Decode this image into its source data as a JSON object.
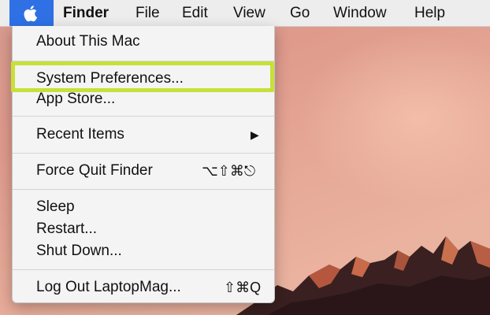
{
  "menubar": {
    "apple_icon": "apple-logo",
    "items": [
      {
        "label": "Finder"
      },
      {
        "label": "File"
      },
      {
        "label": "Edit"
      },
      {
        "label": "View"
      },
      {
        "label": "Go"
      },
      {
        "label": "Window"
      },
      {
        "label": "Help"
      }
    ]
  },
  "apple_menu": {
    "items": [
      {
        "label": "About This Mac"
      },
      {
        "label": "System Preferences..."
      },
      {
        "label": "App Store..."
      },
      {
        "label": "Recent Items",
        "submenu_indicator": "▶"
      },
      {
        "label": "Force Quit Finder",
        "shortcut": "⌥⇧⌘⎋"
      },
      {
        "label": "Sleep"
      },
      {
        "label": "Restart..."
      },
      {
        "label": "Shut Down..."
      },
      {
        "label": "Log Out LaptopMag...",
        "shortcut": "⇧⌘Q"
      }
    ]
  },
  "colors": {
    "apple_menu_active": "#2f71e5",
    "highlight_outline": "#c7e03a",
    "menu_background": "#f4f4f4"
  }
}
